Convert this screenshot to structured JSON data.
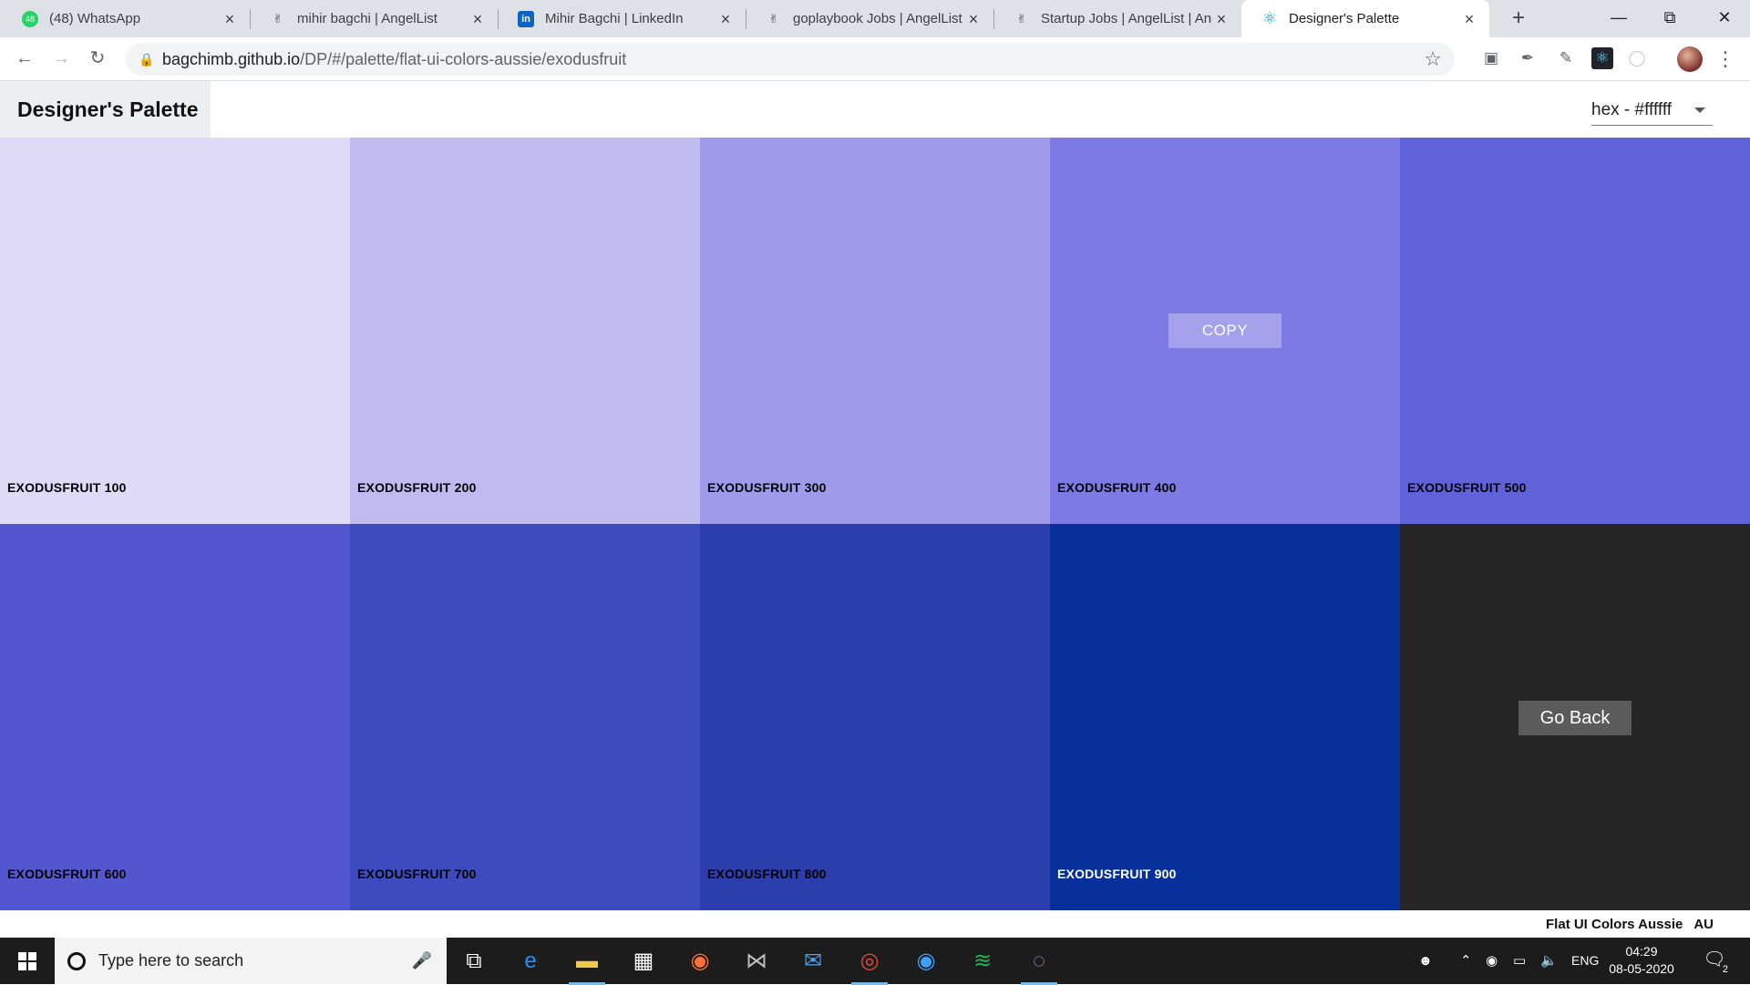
{
  "browser": {
    "tabs": [
      {
        "title": "(48) WhatsApp",
        "icon": "whatsapp-icon",
        "glyph": "48",
        "active": false
      },
      {
        "title": "mihir bagchi | AngelList",
        "icon": "angellist-icon",
        "glyph": "✌",
        "active": false
      },
      {
        "title": "Mihir Bagchi | LinkedIn",
        "icon": "linkedin-icon",
        "glyph": "in",
        "active": false
      },
      {
        "title": "goplaybook Jobs | AngelList",
        "icon": "angellist-icon",
        "glyph": "✌",
        "active": false
      },
      {
        "title": "Startup Jobs | AngelList | Ang",
        "icon": "angellist-icon",
        "glyph": "✌",
        "active": false
      },
      {
        "title": "Designer's Palette",
        "icon": "react-icon",
        "glyph": "⚛",
        "active": true
      }
    ],
    "url_host": "bagchimb.github.io",
    "url_path": "/DP/#/palette/flat-ui-colors-aussie/exodusfruit"
  },
  "app": {
    "logo": "Designer's Palette",
    "format_label": "hex - #ffffff",
    "copy_label": "COPY",
    "go_back_label": "Go Back",
    "footer_name": "Flat UI Colors Aussie",
    "footer_emoji": "AU",
    "swatches": [
      {
        "name": "exodusfruit 100",
        "color": "#dedaf7",
        "text": "#000000"
      },
      {
        "name": "exodusfruit 200",
        "color": "#c0baf0",
        "text": "#000000"
      },
      {
        "name": "exodusfruit 300",
        "color": "#a09aea",
        "text": "#000000"
      },
      {
        "name": "exodusfruit 400",
        "color": "#7e7ae3",
        "text": "#000000"
      },
      {
        "name": "exodusfruit 500",
        "color": "#5f62d9",
        "text": "#000000"
      },
      {
        "name": "exodusfruit 600",
        "color": "#5257cf",
        "text": "#000000"
      },
      {
        "name": "exodusfruit 700",
        "color": "#3c4bbd",
        "text": "#000000"
      },
      {
        "name": "exodusfruit 800",
        "color": "#2b3eab",
        "text": "#000000"
      },
      {
        "name": "exodusfruit 900",
        "color": "#08309a",
        "text": "#ffffff"
      }
    ],
    "go_back_bg": "#262626"
  },
  "taskbar": {
    "search_placeholder": "Type here to search",
    "language": "ENG",
    "time": "04:29",
    "date": "08-05-2020",
    "notification_count": "2",
    "apps": [
      "task-view-icon",
      "edge-icon",
      "file-explorer-icon",
      "store-icon",
      "firefox-icon",
      "predator-icon",
      "mail-icon",
      "chrome-icon",
      "firefox-dev-icon",
      "spotify-icon",
      "tor-icon"
    ]
  }
}
